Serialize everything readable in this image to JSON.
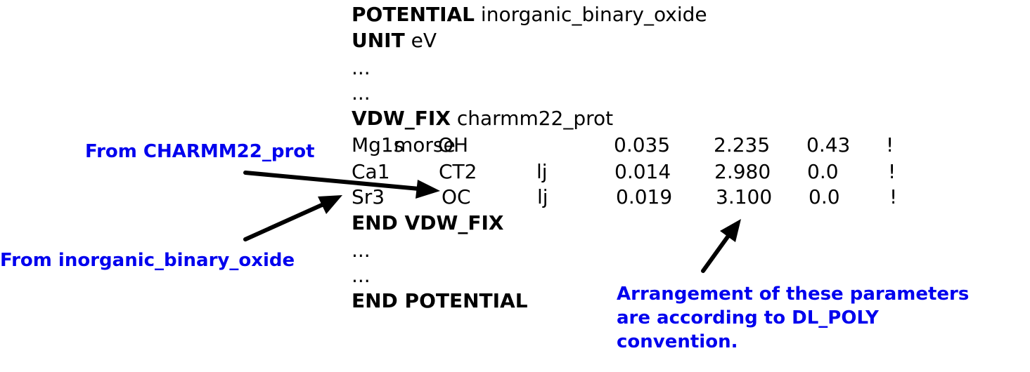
{
  "header": {
    "potential_keyword": "POTENTIAL",
    "potential_name": "inorganic_binary_oxide",
    "unit_keyword": "UNIT",
    "unit_value": "eV",
    "ellipsis_1": "...",
    "ellipsis_2": "..."
  },
  "vdw_fix": {
    "keyword": "VDW_FIX",
    "name": "charmm22_prot",
    "rows": [
      {
        "atom1": "Mg1s",
        "atom2": "OH",
        "type": "morse",
        "p1": "0.035",
        "p2": "2.235",
        "p3": "0.43",
        "comment": "!"
      },
      {
        "atom1": "Ca1",
        "atom2": "CT2",
        "type": "lj",
        "p1": "0.014",
        "p2": "2.980",
        "p3": "0.0",
        "comment": "!"
      },
      {
        "atom1": "Sr3",
        "atom2": "OC",
        "type": "lj",
        "p1": "0.019",
        "p2": "3.100",
        "p3": "0.0",
        "comment": "!"
      }
    ],
    "end_label": "END VDW_FIX"
  },
  "footer": {
    "ellipsis_1": "...",
    "ellipsis_2": "...",
    "end_label": "END POTENTIAL"
  },
  "annotations": {
    "from_charmm": "From CHARMM22_prot",
    "from_inorganic": "From inorganic_binary_oxide",
    "arrangement_line1": "Arrangement of these parameters",
    "arrangement_line2": "are according to DL_POLY",
    "arrangement_line3": "convention."
  },
  "colors": {
    "annotation_text": "#0000ee",
    "code_text": "#000000",
    "arrow": "#000000"
  }
}
